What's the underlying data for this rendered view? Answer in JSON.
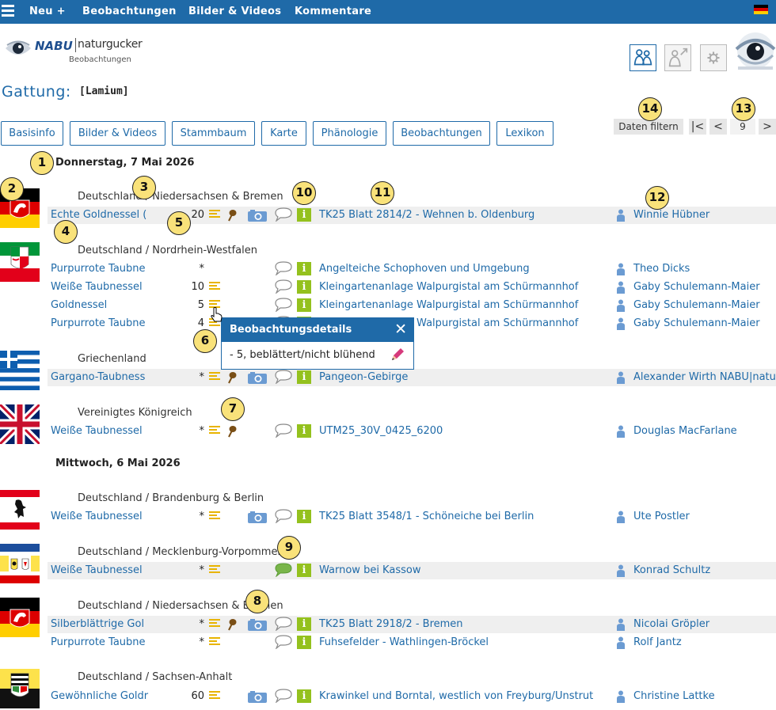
{
  "topbar": {
    "items": [
      "Neu +",
      "Beobachtungen",
      "Bilder & Videos",
      "Kommentare"
    ]
  },
  "header": {
    "logo_brand": "NABU",
    "logo_name": "naturgucker",
    "logo_sub": "Beobachtungen",
    "gattung_label": "Gattung:",
    "gattung_value": "[Lamium]"
  },
  "tabs": [
    "Basisinfo",
    "Bilder & Videos",
    "Stammbaum",
    "Karte",
    "Phänologie",
    "Beobachtungen",
    "Lexikon"
  ],
  "pager": {
    "filter_label": "Daten filtern",
    "first": "|<",
    "prev": "<",
    "page": "9",
    "next": ">"
  },
  "dates": [
    "Donnerstag, 7 Mai 2026",
    "Mittwoch, 6 Mai 2026"
  ],
  "regions": [
    "Deutschland / Niedersachsen & Bremen",
    "Deutschland / Nordrhein-Westfalen",
    "Griechenland",
    "Vereinigtes Königreich",
    "Deutschland / Brandenburg & Berlin",
    "Deutschland / Mecklenburg-Vorpommern",
    "Deutschland / Niedersachsen & Bremen",
    "Deutschland / Sachsen-Anhalt"
  ],
  "rows": [
    {
      "species": "Echte Goldnessel (",
      "count": "20",
      "location": "TK25 Blatt 2814/2 - Wehnen b. Oldenburg",
      "observer": "Winnie Hübner"
    },
    {
      "species": "Purpurrote Taubne",
      "count": "*",
      "location": "Angelteiche Schophoven und Umgebung",
      "observer": "Theo Dicks"
    },
    {
      "species": "Weiße Taubnessel",
      "count": "10",
      "location": "Kleingartenanlage Walpurgistal am Schürmannhof",
      "observer": "Gaby Schulemann-Maier"
    },
    {
      "species": "Goldnessel",
      "count": "5",
      "location": "Kleingartenanlage Walpurgistal am Schürmannhof",
      "observer": "Gaby Schulemann-Maier"
    },
    {
      "species": "Purpurrote Taubne",
      "count": "4",
      "location": "Kleingartenanlage Walpurgistal am Schürmannhof",
      "observer": "Gaby Schulemann-Maier"
    },
    {
      "species": "Gargano-Taubness",
      "count": "*",
      "location": "Pangeon-Gebirge",
      "observer": "Alexander Wirth NABU|naturgucker"
    },
    {
      "species": "Weiße Taubnessel",
      "count": "*",
      "location": "UTM25_30V_0425_6200",
      "observer": "Douglas MacFarlane"
    },
    {
      "species": "Weiße Taubnessel",
      "count": "*",
      "location": "TK25 Blatt 3548/1 - Schöneiche bei Berlin",
      "observer": "Ute Postler"
    },
    {
      "species": "Weiße Taubnessel",
      "count": "*",
      "location": "Warnow bei Kassow",
      "observer": "Konrad Schultz"
    },
    {
      "species": "Silberblättrige Gol",
      "count": "*",
      "location": "TK25 Blatt 2918/2 - Bremen",
      "observer": "Nicolai Gröpler"
    },
    {
      "species": "Purpurrote Taubne",
      "count": "*",
      "location": "Fuhsefelder - Wathlingen-Bröckel",
      "observer": "Rolf Jantz"
    },
    {
      "species": "Gewöhnliche Goldr",
      "count": "60",
      "location": "Krawinkel und Borntal, westlich von Freyburg/Unstrut",
      "observer": "Christine Lattke"
    }
  ],
  "popup": {
    "title": "Beobachtungsdetails",
    "close": "✕",
    "detail": "-  5, beblättert/nicht blühend"
  },
  "badges": [
    "1",
    "2",
    "3",
    "4",
    "5",
    "6",
    "7",
    "8",
    "9",
    "10",
    "11",
    "12",
    "13",
    "14"
  ],
  "colors": {
    "nav_blue": "#1f6aa8",
    "badge_yellow": "#f9e27a",
    "info_green": "#94c11e",
    "list_yellow": "#e8b400",
    "pin_brown": "#7a4f16",
    "camera_blue": "#6b9bd2"
  },
  "icons": [
    "menu-icon",
    "german-flag-icon",
    "users-icon",
    "share-icon",
    "gear-icon",
    "list-icon",
    "pin-icon",
    "camera-icon",
    "comment-icon",
    "info-icon",
    "user-icon",
    "pencil-icon",
    "pointer-cursor-icon"
  ]
}
